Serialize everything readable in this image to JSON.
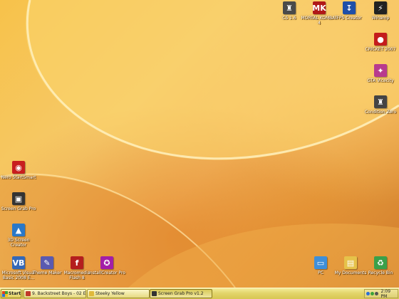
{
  "desktop": {
    "icons": [
      {
        "label": "CS 1.6",
        "icon": "counter-strike-icon",
        "color": "#4a4a4a",
        "glyph": "♜"
      },
      {
        "label": "MORTAL KOMBAT 4",
        "icon": "mortal-kombat-icon",
        "color": "#b01818",
        "glyph": "MK"
      },
      {
        "label": "FPS Creator",
        "icon": "fps-creator-icon",
        "color": "#1e4fa8",
        "glyph": "↧"
      },
      {
        "label": "Winamp",
        "icon": "winamp-icon",
        "color": "#222222",
        "glyph": "⚡"
      },
      {
        "label": "CRICKET 2007",
        "icon": "cricket-icon",
        "color": "#c41c1c",
        "glyph": "●"
      },
      {
        "label": "GTA Vicecity",
        "icon": "gta-icon",
        "color": "#b83a8e",
        "glyph": "✦"
      },
      {
        "label": "Condition Zero",
        "icon": "condition-zero-icon",
        "color": "#444444",
        "glyph": "♜"
      },
      {
        "label": "Nero StartSmart",
        "icon": "nero-icon",
        "color": "#c81e1e",
        "glyph": "◉"
      },
      {
        "label": "Screen Grab Pro",
        "icon": "screen-grab-icon",
        "color": "#333333",
        "glyph": "▣"
      },
      {
        "label": "3D Screen Creator",
        "icon": "screen-creator-icon",
        "color": "#2a78c8",
        "glyph": "▲"
      },
      {
        "label": "Microsoft Visual Basic 2008 E...",
        "icon": "visual-basic-icon",
        "color": "#3468b8",
        "glyph": "VB"
      },
      {
        "label": "Theme Maker",
        "icon": "theme-maker-icon",
        "color": "#5a5ab0",
        "glyph": "✎"
      },
      {
        "label": "Macromedia Flash 8",
        "icon": "flash-icon",
        "color": "#b41e1e",
        "glyph": "f"
      },
      {
        "label": "InstallCreator Pro",
        "icon": "install-creator-icon",
        "color": "#a21ea8",
        "glyph": "✪"
      },
      {
        "label": "PC",
        "icon": "computer-icon",
        "color": "#3f8fd8",
        "glyph": "▭"
      },
      {
        "label": "My Documents",
        "icon": "documents-icon",
        "color": "#e6c24a",
        "glyph": "▤"
      },
      {
        "label": "Recycle Bin",
        "icon": "recycle-bin-icon",
        "color": "#3aa04a",
        "glyph": "♻"
      }
    ]
  },
  "taskbar": {
    "start_label": "Start",
    "tasks": [
      {
        "label": "9. Backstreet Boys - 02 E...",
        "icon": "winamp-task-icon",
        "color": "#c0392b"
      },
      {
        "label": "Steeky Yellow",
        "icon": "folder-task-icon",
        "color": "#e0b93a"
      },
      {
        "label": "Screen Grab Pro v1.2",
        "icon": "screen-grab-task-icon",
        "color": "#333333"
      }
    ],
    "tray": {
      "clock": "2:09 PM",
      "icons": [
        "arrows-tray-icon",
        "network-tray-icon",
        "volume-tray-icon"
      ]
    }
  }
}
